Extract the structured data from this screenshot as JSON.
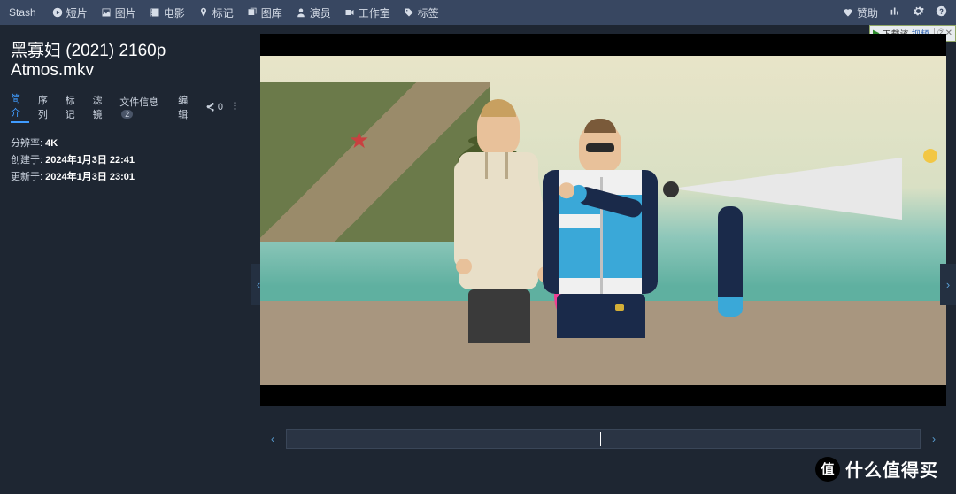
{
  "brand": "Stash",
  "nav": [
    {
      "icon": "play-circle",
      "label": "短片"
    },
    {
      "icon": "image",
      "label": "图片"
    },
    {
      "icon": "film",
      "label": "电影"
    },
    {
      "icon": "pin",
      "label": "标记"
    },
    {
      "icon": "layers",
      "label": "图库"
    },
    {
      "icon": "user",
      "label": "演员"
    },
    {
      "icon": "video",
      "label": "工作室"
    },
    {
      "icon": "tag",
      "label": "标签"
    }
  ],
  "nav_right": {
    "donate": "赞助"
  },
  "download_badge": {
    "text": "下载该",
    "text2": "视频",
    "hint": "②✕"
  },
  "title": "黑寡妇 (2021) 2160p Atmos.mkv",
  "tabs": {
    "items": [
      "简介",
      "序列",
      "标记",
      "滤镜"
    ],
    "file_info_label": "文件信息",
    "file_info_count": "2",
    "edit": "编辑",
    "share_count": "0"
  },
  "details": {
    "resolution_label": "分辨率:",
    "resolution_value": "4K",
    "created_label": "创建于:",
    "created_value": "2024年1月3日 22:41",
    "updated_label": "更新于:",
    "updated_value": "2024年1月3日 23:01"
  },
  "watermark": {
    "circle": "值",
    "text": "什么值得买"
  }
}
